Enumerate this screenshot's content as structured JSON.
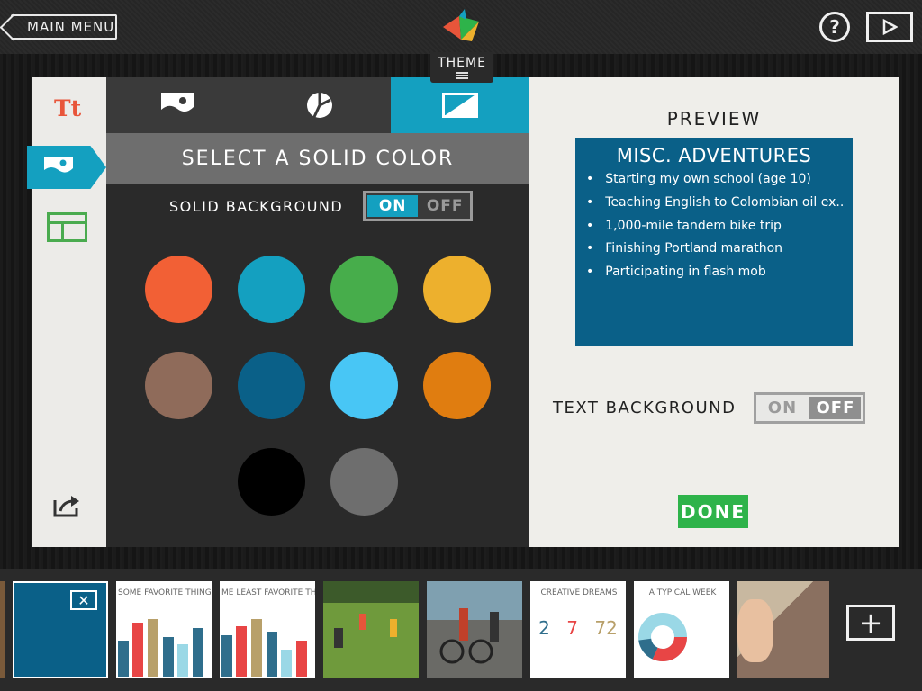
{
  "topbar": {
    "main_menu_label": "MAIN MENU",
    "help_label": "?",
    "theme_tab_label": "THEME"
  },
  "panel": {
    "header": "SELECT A SOLID COLOR",
    "solid_background_label": "SOLID BACKGROUND",
    "solid_toggle": {
      "on": "ON",
      "off": "OFF",
      "state": "on"
    },
    "swatches": [
      "#f26035",
      "#14a0c0",
      "#47ad4b",
      "#edb02d",
      "#8f6b5a",
      "#0a6088",
      "#48c6f5",
      "#e07d10",
      "#000000",
      "#6e6e6e"
    ]
  },
  "preview": {
    "label": "PREVIEW",
    "title": "MISC. ADVENTURES",
    "bullets": [
      "Starting my own school (age 10)",
      "Teaching English to Colombian oil ex...",
      "1,000-mile tandem bike trip",
      "Finishing Portland marathon",
      "Participating in flash mob"
    ],
    "text_background_label": "TEXT BACKGROUND",
    "text_toggle": {
      "on": "ON",
      "off": "OFF",
      "state": "off"
    },
    "done_label": "DONE"
  },
  "filmstrip": {
    "thumbs": [
      {
        "kind": "color",
        "color": "#0a6088"
      },
      {
        "kind": "chart",
        "title": "SOME FAVORITE THINGS"
      },
      {
        "kind": "chart",
        "title": "ME LEAST FAVORITE THIN"
      },
      {
        "kind": "photo",
        "subject": "soccer"
      },
      {
        "kind": "photo",
        "subject": "bikes"
      },
      {
        "kind": "text",
        "title": "CREATIVE DREAMS",
        "numbers": [
          "2",
          "7",
          "72"
        ]
      },
      {
        "kind": "pie",
        "title": "A TYPICAL WEEK"
      },
      {
        "kind": "photo",
        "subject": "kitchen"
      }
    ],
    "add_label": "+"
  },
  "colors": {
    "accent": "#14a0c0",
    "done_green": "#2eb34a",
    "card_blue": "#0a6088"
  }
}
